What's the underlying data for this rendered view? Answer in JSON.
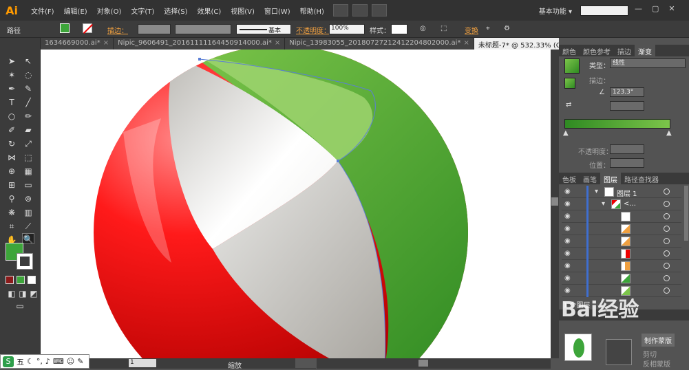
{
  "app": {
    "logo": "Ai",
    "workspace": "基本功能",
    "workspace_arrow": "▾"
  },
  "menu": [
    "文件(F)",
    "编辑(E)",
    "对象(O)",
    "文字(T)",
    "选择(S)",
    "效果(C)",
    "视图(V)",
    "窗口(W)",
    "帮助(H)"
  ],
  "window_buttons": [
    "—",
    "▢",
    "✕"
  ],
  "control_bar": {
    "label_path": "路径",
    "stroke_label": "描边：",
    "basic_label": "基本",
    "opacity_label": "不透明度：",
    "opacity_value": "100%",
    "style_label": "样式：",
    "transform_label": "变换"
  },
  "tabs": [
    {
      "label": "1634669000.ai*",
      "active": false
    },
    {
      "label": "Nipic_9606491_20161111164450914000.ai*",
      "active": false
    },
    {
      "label": "Nipic_13983055_20180727212412204802000.ai*",
      "active": false
    },
    {
      "label": "未标题-7* @ 532.33% (CMYK/预览)",
      "active": true
    }
  ],
  "gradient_panel": {
    "tabs": [
      "颜色",
      "颜色参考",
      "描边",
      "渐变"
    ],
    "active_tab": "渐变",
    "type_label": "类型：",
    "type_value": "线性",
    "stroke_label": "描边：",
    "angle_value": "123.3°",
    "opacity_label": "不透明度：",
    "position_label": "位置：",
    "gradient_start": "#2f8a22",
    "gradient_end": "#7cc54a"
  },
  "layers_panel": {
    "tabs": [
      "色板",
      "画笔",
      "图层",
      "路径查找器"
    ],
    "active_tab": "图层",
    "layer_name": "图层 1",
    "group_name": "<...",
    "count_label": "1 个图层",
    "rows": 9
  },
  "lower_panel": {
    "make_mask": "制作蒙版",
    "clip": "剪切",
    "invert_mask": "反相蒙版"
  },
  "status": {
    "zoom_value": "1",
    "state_label": "缩放"
  },
  "ime": {
    "label": "五"
  },
  "watermark": "Bai经验",
  "colors": {
    "red": "#e00000",
    "green": "#3da53a",
    "white_segment": "#ececea"
  }
}
